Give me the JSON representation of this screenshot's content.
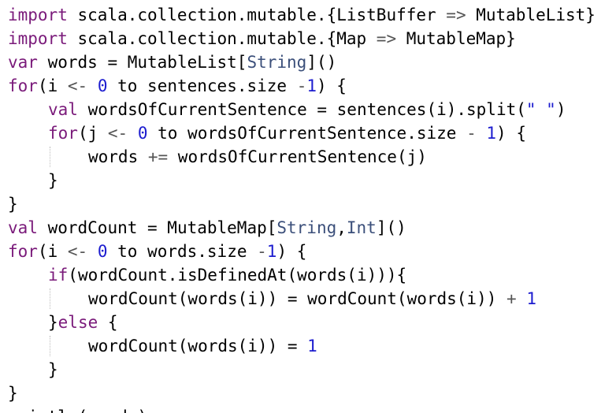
{
  "editor": {
    "language": "scala",
    "lines": [
      {
        "indent": 0,
        "tokens": [
          {
            "t": "import",
            "c": "kw"
          },
          {
            "t": " scala.collection.mutable.{ListBuffer ",
            "c": "plain"
          },
          {
            "t": "=>",
            "c": "op"
          },
          {
            "t": " MutableList}",
            "c": "plain"
          }
        ]
      },
      {
        "indent": 0,
        "tokens": [
          {
            "t": "import",
            "c": "kw"
          },
          {
            "t": " scala.collection.mutable.{Map ",
            "c": "plain"
          },
          {
            "t": "=>",
            "c": "op"
          },
          {
            "t": " MutableMap}",
            "c": "plain"
          }
        ]
      },
      {
        "indent": 0,
        "tokens": [
          {
            "t": "var",
            "c": "kw"
          },
          {
            "t": " words = MutableList[",
            "c": "plain"
          },
          {
            "t": "String",
            "c": "type"
          },
          {
            "t": "]()",
            "c": "plain"
          }
        ]
      },
      {
        "indent": 0,
        "tokens": [
          {
            "t": "for",
            "c": "kw"
          },
          {
            "t": "(i ",
            "c": "plain"
          },
          {
            "t": "<-",
            "c": "op"
          },
          {
            "t": " ",
            "c": "plain"
          },
          {
            "t": "0",
            "c": "num"
          },
          {
            "t": " to sentences.size ",
            "c": "plain"
          },
          {
            "t": "-",
            "c": "op"
          },
          {
            "t": "1",
            "c": "num"
          },
          {
            "t": ") {",
            "c": "plain"
          }
        ]
      },
      {
        "indent": 1,
        "tokens": [
          {
            "t": "val",
            "c": "kw"
          },
          {
            "t": " wordsOfCurrentSentence = sentences(i).split(",
            "c": "plain"
          },
          {
            "t": "\" \"",
            "c": "str"
          },
          {
            "t": ")",
            "c": "plain"
          }
        ]
      },
      {
        "indent": 1,
        "tokens": [
          {
            "t": "for",
            "c": "kw"
          },
          {
            "t": "(j ",
            "c": "plain"
          },
          {
            "t": "<-",
            "c": "op"
          },
          {
            "t": " ",
            "c": "plain"
          },
          {
            "t": "0",
            "c": "num"
          },
          {
            "t": " to wordsOfCurrentSentence.size ",
            "c": "plain"
          },
          {
            "t": "-",
            "c": "op"
          },
          {
            "t": " ",
            "c": "plain"
          },
          {
            "t": "1",
            "c": "num"
          },
          {
            "t": ") {",
            "c": "plain"
          }
        ]
      },
      {
        "indent": 2,
        "tokens": [
          {
            "t": "words ",
            "c": "plain"
          },
          {
            "t": "+=",
            "c": "op"
          },
          {
            "t": " wordsOfCurrentSentence(j)",
            "c": "plain"
          }
        ]
      },
      {
        "indent": 1,
        "tokens": [
          {
            "t": "}",
            "c": "plain"
          }
        ]
      },
      {
        "indent": 0,
        "tokens": [
          {
            "t": "}",
            "c": "plain"
          }
        ]
      },
      {
        "indent": 0,
        "tokens": [
          {
            "t": "val",
            "c": "kw"
          },
          {
            "t": " wordCount = MutableMap[",
            "c": "plain"
          },
          {
            "t": "String",
            "c": "type"
          },
          {
            "t": ",",
            "c": "plain"
          },
          {
            "t": "Int",
            "c": "type"
          },
          {
            "t": "]()",
            "c": "plain"
          }
        ]
      },
      {
        "indent": 0,
        "tokens": [
          {
            "t": "for",
            "c": "kw"
          },
          {
            "t": "(i ",
            "c": "plain"
          },
          {
            "t": "<-",
            "c": "op"
          },
          {
            "t": " ",
            "c": "plain"
          },
          {
            "t": "0",
            "c": "num"
          },
          {
            "t": " to words.size ",
            "c": "plain"
          },
          {
            "t": "-",
            "c": "op"
          },
          {
            "t": "1",
            "c": "num"
          },
          {
            "t": ") {",
            "c": "plain"
          }
        ]
      },
      {
        "indent": 1,
        "tokens": [
          {
            "t": "if",
            "c": "kw"
          },
          {
            "t": "(wordCount.isDefinedAt(words(i))){",
            "c": "plain"
          }
        ]
      },
      {
        "indent": 2,
        "tokens": [
          {
            "t": "wordCount(words(i)) = wordCount(words(i)) ",
            "c": "plain"
          },
          {
            "t": "+",
            "c": "op"
          },
          {
            "t": " ",
            "c": "plain"
          },
          {
            "t": "1",
            "c": "num"
          }
        ]
      },
      {
        "indent": 1,
        "tokens": [
          {
            "t": "}",
            "c": "plain"
          },
          {
            "t": "else",
            "c": "kw"
          },
          {
            "t": " {",
            "c": "plain"
          }
        ]
      },
      {
        "indent": 2,
        "tokens": [
          {
            "t": "wordCount(words(i)) = ",
            "c": "plain"
          },
          {
            "t": "1",
            "c": "num"
          }
        ]
      },
      {
        "indent": 1,
        "tokens": [
          {
            "t": "}",
            "c": "plain"
          }
        ]
      },
      {
        "indent": 0,
        "tokens": [
          {
            "t": "}",
            "c": "plain"
          }
        ]
      },
      {
        "indent": 0,
        "tokens": [
          {
            "t": "println(words)",
            "c": "plain"
          }
        ]
      }
    ]
  }
}
